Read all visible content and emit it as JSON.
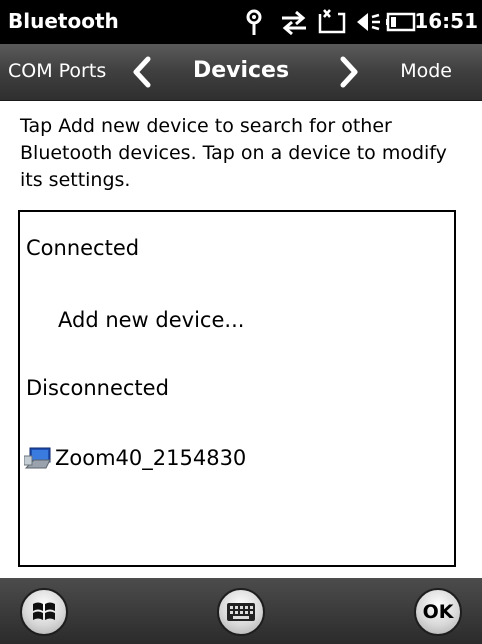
{
  "status_bar": {
    "title": "Bluetooth",
    "time": "16:51",
    "icons": [
      "signal-antenna-icon",
      "sync-arrows-icon",
      "message-icon",
      "speaker-icon",
      "battery-icon"
    ]
  },
  "nav": {
    "prev_label": "COM Ports",
    "current_label": "Devices",
    "next_label": "Mode"
  },
  "instructions": "Tap Add new device to search for other Bluetooth devices. Tap on a device to modify its settings.",
  "device_list": {
    "connected_header": "Connected",
    "add_device_label": "Add new device...",
    "disconnected_header": "Disconnected",
    "devices": [
      {
        "name": "Zoom40_2154830",
        "icon": "computer-icon"
      }
    ]
  },
  "bottom_bar": {
    "start_icon": "windows-flag-icon",
    "keyboard_icon": "keyboard-icon",
    "ok_label": "OK"
  },
  "colors": {
    "status_bg": "#000000",
    "nav_bg": "#3f3f3f",
    "text": "#000000",
    "content_bg": "#ffffff"
  }
}
